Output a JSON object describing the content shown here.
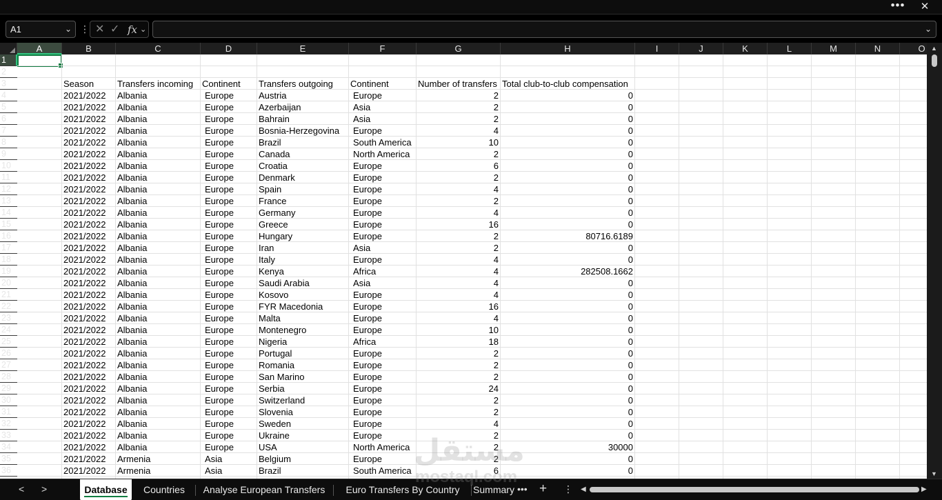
{
  "titlebar": {
    "more_label": "•••",
    "close_label": "✕"
  },
  "formula_bar": {
    "name_box": "A1",
    "formula": ""
  },
  "columns": [
    "A",
    "B",
    "C",
    "D",
    "E",
    "F",
    "G",
    "H",
    "I",
    "J",
    "K",
    "L",
    "M",
    "N",
    "O"
  ],
  "active_column": "A",
  "active_row": "1",
  "table": {
    "headers": {
      "season": "Season",
      "incoming": "Transfers incoming",
      "continent_in": "Continent",
      "outgoing": "Transfers outgoing",
      "continent_out": "Continent",
      "count": "Number of transfers",
      "compensation": "Total club-to-club compensation"
    },
    "rows": [
      {
        "row": "4",
        "season": "2021/2022",
        "incoming": "Albania",
        "cin": "Europe",
        "outgoing": "Austria",
        "cout": "Europe",
        "count": "2",
        "comp": "0"
      },
      {
        "row": "5",
        "season": "2021/2022",
        "incoming": "Albania",
        "cin": "Europe",
        "outgoing": "Azerbaijan",
        "cout": "Asia",
        "count": "2",
        "comp": "0"
      },
      {
        "row": "6",
        "season": "2021/2022",
        "incoming": "Albania",
        "cin": "Europe",
        "outgoing": "Bahrain",
        "cout": "Asia",
        "count": "2",
        "comp": "0"
      },
      {
        "row": "7",
        "season": "2021/2022",
        "incoming": "Albania",
        "cin": "Europe",
        "outgoing": "Bosnia-Herzegovina",
        "cout": "Europe",
        "count": "4",
        "comp": "0"
      },
      {
        "row": "8",
        "season": "2021/2022",
        "incoming": "Albania",
        "cin": "Europe",
        "outgoing": "Brazil",
        "cout": "South America",
        "count": "10",
        "comp": "0"
      },
      {
        "row": "9",
        "season": "2021/2022",
        "incoming": "Albania",
        "cin": "Europe",
        "outgoing": "Canada",
        "cout": "North America",
        "count": "2",
        "comp": "0"
      },
      {
        "row": "10",
        "season": "2021/2022",
        "incoming": "Albania",
        "cin": "Europe",
        "outgoing": "Croatia",
        "cout": "Europe",
        "count": "6",
        "comp": "0"
      },
      {
        "row": "11",
        "season": "2021/2022",
        "incoming": "Albania",
        "cin": "Europe",
        "outgoing": "Denmark",
        "cout": "Europe",
        "count": "2",
        "comp": "0"
      },
      {
        "row": "12",
        "season": "2021/2022",
        "incoming": "Albania",
        "cin": "Europe",
        "outgoing": "Spain",
        "cout": "Europe",
        "count": "4",
        "comp": "0"
      },
      {
        "row": "13",
        "season": "2021/2022",
        "incoming": "Albania",
        "cin": "Europe",
        "outgoing": "France",
        "cout": "Europe",
        "count": "2",
        "comp": "0"
      },
      {
        "row": "14",
        "season": "2021/2022",
        "incoming": "Albania",
        "cin": "Europe",
        "outgoing": "Germany",
        "cout": "Europe",
        "count": "4",
        "comp": "0"
      },
      {
        "row": "15",
        "season": "2021/2022",
        "incoming": "Albania",
        "cin": "Europe",
        "outgoing": "Greece",
        "cout": "Europe",
        "count": "16",
        "comp": "0"
      },
      {
        "row": "16",
        "season": "2021/2022",
        "incoming": "Albania",
        "cin": "Europe",
        "outgoing": "Hungary",
        "cout": "Europe",
        "count": "2",
        "comp": "80716.6189"
      },
      {
        "row": "17",
        "season": "2021/2022",
        "incoming": "Albania",
        "cin": "Europe",
        "outgoing": "Iran",
        "cout": "Asia",
        "count": "2",
        "comp": "0"
      },
      {
        "row": "18",
        "season": "2021/2022",
        "incoming": "Albania",
        "cin": "Europe",
        "outgoing": "Italy",
        "cout": "Europe",
        "count": "4",
        "comp": "0"
      },
      {
        "row": "19",
        "season": "2021/2022",
        "incoming": "Albania",
        "cin": "Europe",
        "outgoing": "Kenya",
        "cout": "Africa",
        "count": "4",
        "comp": "282508.1662"
      },
      {
        "row": "20",
        "season": "2021/2022",
        "incoming": "Albania",
        "cin": "Europe",
        "outgoing": "Saudi Arabia",
        "cout": "Asia",
        "count": "4",
        "comp": "0"
      },
      {
        "row": "21",
        "season": "2021/2022",
        "incoming": "Albania",
        "cin": "Europe",
        "outgoing": "Kosovo",
        "cout": "Europe",
        "count": "4",
        "comp": "0"
      },
      {
        "row": "22",
        "season": "2021/2022",
        "incoming": "Albania",
        "cin": "Europe",
        "outgoing": "FYR Macedonia",
        "cout": "Europe",
        "count": "16",
        "comp": "0"
      },
      {
        "row": "23",
        "season": "2021/2022",
        "incoming": "Albania",
        "cin": "Europe",
        "outgoing": "Malta",
        "cout": "Europe",
        "count": "4",
        "comp": "0"
      },
      {
        "row": "24",
        "season": "2021/2022",
        "incoming": "Albania",
        "cin": "Europe",
        "outgoing": "Montenegro",
        "cout": "Europe",
        "count": "10",
        "comp": "0"
      },
      {
        "row": "25",
        "season": "2021/2022",
        "incoming": "Albania",
        "cin": "Europe",
        "outgoing": "Nigeria",
        "cout": "Africa",
        "count": "18",
        "comp": "0"
      },
      {
        "row": "26",
        "season": "2021/2022",
        "incoming": "Albania",
        "cin": "Europe",
        "outgoing": "Portugal",
        "cout": "Europe",
        "count": "2",
        "comp": "0"
      },
      {
        "row": "27",
        "season": "2021/2022",
        "incoming": "Albania",
        "cin": "Europe",
        "outgoing": "Romania",
        "cout": "Europe",
        "count": "2",
        "comp": "0"
      },
      {
        "row": "28",
        "season": "2021/2022",
        "incoming": "Albania",
        "cin": "Europe",
        "outgoing": "San Marino",
        "cout": "Europe",
        "count": "2",
        "comp": "0"
      },
      {
        "row": "29",
        "season": "2021/2022",
        "incoming": "Albania",
        "cin": "Europe",
        "outgoing": "Serbia",
        "cout": "Europe",
        "count": "24",
        "comp": "0"
      },
      {
        "row": "30",
        "season": "2021/2022",
        "incoming": "Albania",
        "cin": "Europe",
        "outgoing": "Switzerland",
        "cout": "Europe",
        "count": "2",
        "comp": "0"
      },
      {
        "row": "31",
        "season": "2021/2022",
        "incoming": "Albania",
        "cin": "Europe",
        "outgoing": "Slovenia",
        "cout": "Europe",
        "count": "2",
        "comp": "0"
      },
      {
        "row": "32",
        "season": "2021/2022",
        "incoming": "Albania",
        "cin": "Europe",
        "outgoing": "Sweden",
        "cout": "Europe",
        "count": "4",
        "comp": "0"
      },
      {
        "row": "33",
        "season": "2021/2022",
        "incoming": "Albania",
        "cin": "Europe",
        "outgoing": "Ukraine",
        "cout": "Europe",
        "count": "2",
        "comp": "0"
      },
      {
        "row": "34",
        "season": "2021/2022",
        "incoming": "Albania",
        "cin": "Europe",
        "outgoing": "USA",
        "cout": "North America",
        "count": "2",
        "comp": "30000"
      },
      {
        "row": "35",
        "season": "2021/2022",
        "incoming": "Armenia",
        "cin": "Asia",
        "outgoing": "Belgium",
        "cout": "Europe",
        "count": "2",
        "comp": "0"
      },
      {
        "row": "36",
        "season": "2021/2022",
        "incoming": "Armenia",
        "cin": "Asia",
        "outgoing": "Brazil",
        "cout": "South America",
        "count": "6",
        "comp": "0"
      }
    ]
  },
  "sheet_tabs": [
    {
      "label": "Database",
      "active": true
    },
    {
      "label": "Countries",
      "active": false
    },
    {
      "label": "Analyse European Transfers",
      "active": false
    },
    {
      "label": "Euro Transfers By Country",
      "active": false
    },
    {
      "label": "Summary",
      "active": false
    }
  ],
  "watermark": {
    "main": "مستقل",
    "sub": "mostaql.com"
  },
  "colors": {
    "accent": "#107c41",
    "header_bg": "#1f1f1f",
    "chrome_bg": "#0d0d0d"
  }
}
